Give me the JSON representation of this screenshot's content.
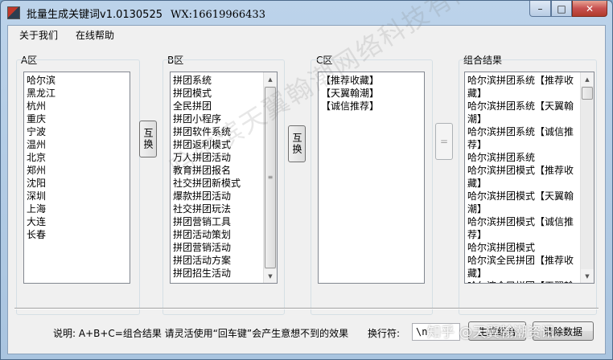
{
  "window": {
    "title": "批量生成关键词v1.0130525",
    "wx": "WX:16619966433",
    "controls": {
      "minimize": "–",
      "maximize": "□",
      "close": "✕"
    }
  },
  "menu": {
    "items": [
      "关于我们",
      "在线帮助"
    ]
  },
  "groups": {
    "a": {
      "label": "A区",
      "items": [
        "哈尔滨",
        "黑龙江",
        "杭州",
        "重庆",
        "宁波",
        "温州",
        "北京",
        "郑州",
        "沈阳",
        "深圳",
        "上海",
        "大连",
        "长春"
      ]
    },
    "b": {
      "label": "B区",
      "items": [
        "拼团系统",
        "拼团模式",
        "全民拼团",
        "拼团小程序",
        "拼团软件系统",
        "拼团返利模式",
        "万人拼团活动",
        "教育拼团报名",
        "社交拼团新模式",
        "爆款拼团活动",
        "社交拼团玩法",
        "拼团营销工具",
        "拼团活动策划",
        "拼团营销活动",
        "拼团活动方案",
        "拼团招生活动"
      ]
    },
    "c": {
      "label": "C区",
      "items": [
        "【推荐收藏】",
        "【天翼翰潮】",
        "【诚信推荐】"
      ]
    },
    "result": {
      "label": "组合结果",
      "items": [
        "哈尔滨拼团系统【推荐收藏】",
        "哈尔滨拼团系统【天翼翰潮】",
        "哈尔滨拼团系统【诚信推荐】",
        "哈尔滨拼团系统",
        "哈尔滨拼团模式【推荐收藏】",
        "哈尔滨拼团模式【天翼翰潮】",
        "哈尔滨拼团模式【诚信推荐】",
        "哈尔滨拼团模式",
        "哈尔滨全民拼团【推荐收藏】",
        "哈尔滨全民拼团【天翼翰潮】"
      ]
    }
  },
  "buttons": {
    "swap1": "互换",
    "swap2": "互换",
    "equals": "="
  },
  "footer": {
    "note": "说明:  A+B+C=组合结果  请灵活使用“回车键”会产生意想不到的效果",
    "separator_label": "换行符:",
    "separator_value": "\\n",
    "generate": "生成组合",
    "clear": "清除数据"
  },
  "overlays": {
    "watermark": "哈尔滨天翼翰潮网络科技有限公司",
    "source": "知乎 @天翼翰潮资讯"
  }
}
